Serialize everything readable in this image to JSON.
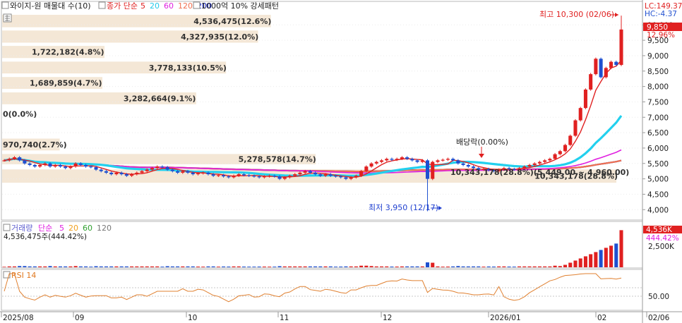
{
  "legend": {
    "series_title": "와이지-원 매물대 수(10)",
    "ma_label": "종가 단순",
    "ma_periods": [
      {
        "label": "5",
        "color": "#e02020"
      },
      {
        "label": "20",
        "color": "#22c8e8"
      },
      {
        "label": "60",
        "color": "#e020e0"
      },
      {
        "label": "120",
        "color": "#f07050"
      },
      {
        "label": "200",
        "color": "#1020c0"
      }
    ],
    "pattern_label": "1000억 10% 강세패턴"
  },
  "right_axis": {
    "lc": "LC:149.37",
    "hc": "HC:-4.37",
    "price_badge": "9,850",
    "change_badge": "12.96%",
    "ticks": [
      "10,000",
      "9,500",
      "9,000",
      "8,500",
      "8,000",
      "7,500",
      "7,000",
      "6,500",
      "6,000",
      "5,500",
      "5,000",
      "4,500",
      "4,000"
    ]
  },
  "annotations": {
    "high": "최고 10,300 (02/06)",
    "low": "최저 3,950 (12/17)",
    "dividend": "배당락(0.00%)",
    "current_label": "10,343,178(28.8%)(5,449.00 ~ 4,960.00)",
    "zero_label": "0(0.0%)"
  },
  "volume_profile": [
    {
      "label": "4,536,475(12.6%)"
    },
    {
      "label": "4,327,935(12.0%)"
    },
    {
      "label": "1,722,182(4.8%)"
    },
    {
      "label": "3,778,133(10.5%)"
    },
    {
      "label": "1,689,859(4.7%)"
    },
    {
      "label": "3,282,664(9.1%)"
    },
    {
      "label": "0(0.0%)"
    },
    {
      "label": "970,740(2.7%)"
    },
    {
      "label": "5,278,578(14.7%)"
    },
    {
      "label": "10,343,178(28.8%)"
    }
  ],
  "volume_panel": {
    "title": "거래량",
    "ma_label": "단순",
    "ma_periods": [
      {
        "label": "5",
        "color": "#e020e0"
      },
      {
        "label": "20",
        "color": "#f0a020"
      },
      {
        "label": "60",
        "color": "#30a030"
      },
      {
        "label": "120",
        "color": "#777777"
      }
    ],
    "value_line": "4,536,475주(444.42%)",
    "badge": "4,536K",
    "badge_pct": "444.42%",
    "tick": "2,500K"
  },
  "rsi_panel": {
    "title": "RSI 14",
    "tick": "50.00"
  },
  "x_axis": {
    "labels": [
      "2025/08",
      "09",
      "10",
      "11",
      "12",
      "2026/01",
      "02",
      "02/06"
    ]
  },
  "chart_data": {
    "type": "candlestick",
    "title": "와이지-원 매물대 수(10)",
    "y_range": [
      3800,
      10350
    ],
    "high": {
      "value": 10300,
      "date": "02/06"
    },
    "low": {
      "value": 3950,
      "date": "12/17"
    },
    "last_close": 9850,
    "change_pct": 12.96,
    "months": [
      "2025/08",
      "09",
      "10",
      "11",
      "12",
      "2026/01",
      "02"
    ],
    "close_series": [
      5600,
      5650,
      5700,
      5600,
      5500,
      5450,
      5400,
      5450,
      5500,
      5400,
      5450,
      5400,
      5350,
      5400,
      5500,
      5450,
      5400,
      5380,
      5300,
      5250,
      5200,
      5150,
      5200,
      5150,
      5100,
      5150,
      5200,
      5250,
      5300,
      5350,
      5400,
      5380,
      5300,
      5250,
      5200,
      5250,
      5200,
      5150,
      5180,
      5200,
      5150,
      5100,
      5120,
      5080,
      5050,
      5100,
      5150,
      5120,
      5100,
      5080,
      5050,
      5080,
      5100,
      5080,
      5000,
      5050,
      5100,
      5150,
      5200,
      5250,
      5200,
      5150,
      5100,
      5150,
      5100,
      5080,
      5050,
      5000,
      5050,
      5100,
      5250,
      5400,
      5500,
      5550,
      5600,
      5650,
      5620,
      5650,
      5700,
      5650,
      5600,
      5550,
      5600,
      5000,
      5550,
      5600,
      5620,
      5650,
      5600,
      5500,
      5450,
      5400,
      5350,
      5300,
      5320,
      5280,
      5250,
      5300,
      5350,
      5320,
      5300,
      5350,
      5400,
      5450,
      5500,
      5550,
      5600,
      5650,
      5800,
      5900,
      6100,
      6400,
      6900,
      7300,
      7900,
      8400,
      8900,
      8300,
      8600,
      8800,
      8700,
      9850
    ],
    "volume_profile_share_pct": [
      12.6,
      12.0,
      4.8,
      10.5,
      4.7,
      9.1,
      0.0,
      2.7,
      14.7,
      28.8
    ],
    "volume_profile_volume": [
      4536475,
      4327935,
      1722182,
      3778133,
      1689859,
      3282664,
      0,
      970740,
      5278578,
      10343178
    ],
    "volume_last": 4536475,
    "volume_last_pct": 444.42,
    "volume_ylim": [
      0,
      5000000
    ],
    "rsi_reference": 50.0
  }
}
